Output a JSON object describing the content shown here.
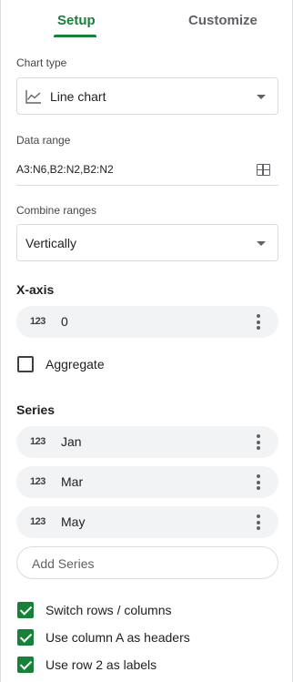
{
  "tabs": {
    "setup": "Setup",
    "customize": "Customize"
  },
  "chart_type": {
    "label": "Chart type",
    "value": "Line chart",
    "icon": "line-chart-icon"
  },
  "data_range": {
    "label": "Data range",
    "value": "A3:N6,B2:N2,B2:N2",
    "icon": "select-range-grid-icon"
  },
  "combine_ranges": {
    "label": "Combine ranges",
    "value": "Vertically"
  },
  "x_axis": {
    "title": "X-axis",
    "chip": {
      "icon_text": "123",
      "label": "0"
    }
  },
  "aggregate": {
    "label": "Aggregate",
    "checked": false
  },
  "series": {
    "title": "Series",
    "items": [
      {
        "icon_text": "123",
        "label": "Jan"
      },
      {
        "icon_text": "123",
        "label": "Mar"
      },
      {
        "icon_text": "123",
        "label": "May"
      }
    ],
    "add_label": "Add Series"
  },
  "options": [
    {
      "label": "Switch rows / columns",
      "checked": true
    },
    {
      "label": "Use column A as headers",
      "checked": true
    },
    {
      "label": "Use row 2 as labels",
      "checked": true
    }
  ],
  "colors": {
    "accent": "#188038",
    "chip_bg": "#f1f3f4",
    "border": "#dadce0"
  }
}
